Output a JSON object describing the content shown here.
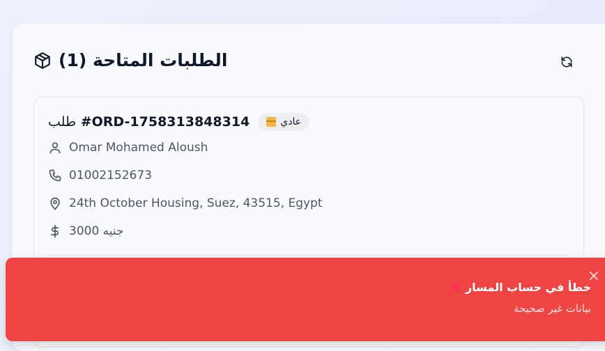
{
  "panel": {
    "title": "الطلبات المتاحة (1)",
    "box_icon": "package-icon",
    "refresh_icon": "refresh-icon"
  },
  "order": {
    "title_ar": "طلب",
    "title_id": "#ORD-1758313848314",
    "priority_label": "عادي",
    "customer_name": "Omar Mohamed Aloush",
    "phone": "01002152673",
    "address": "24th October Housing, Suez, 43515, Egypt",
    "amount": "3000 جنيه"
  },
  "toast": {
    "title": "خطأ في حساب المسار",
    "message": "بيانات غير صحيحة",
    "color": "#ef4444",
    "close_icon": "close-icon"
  }
}
